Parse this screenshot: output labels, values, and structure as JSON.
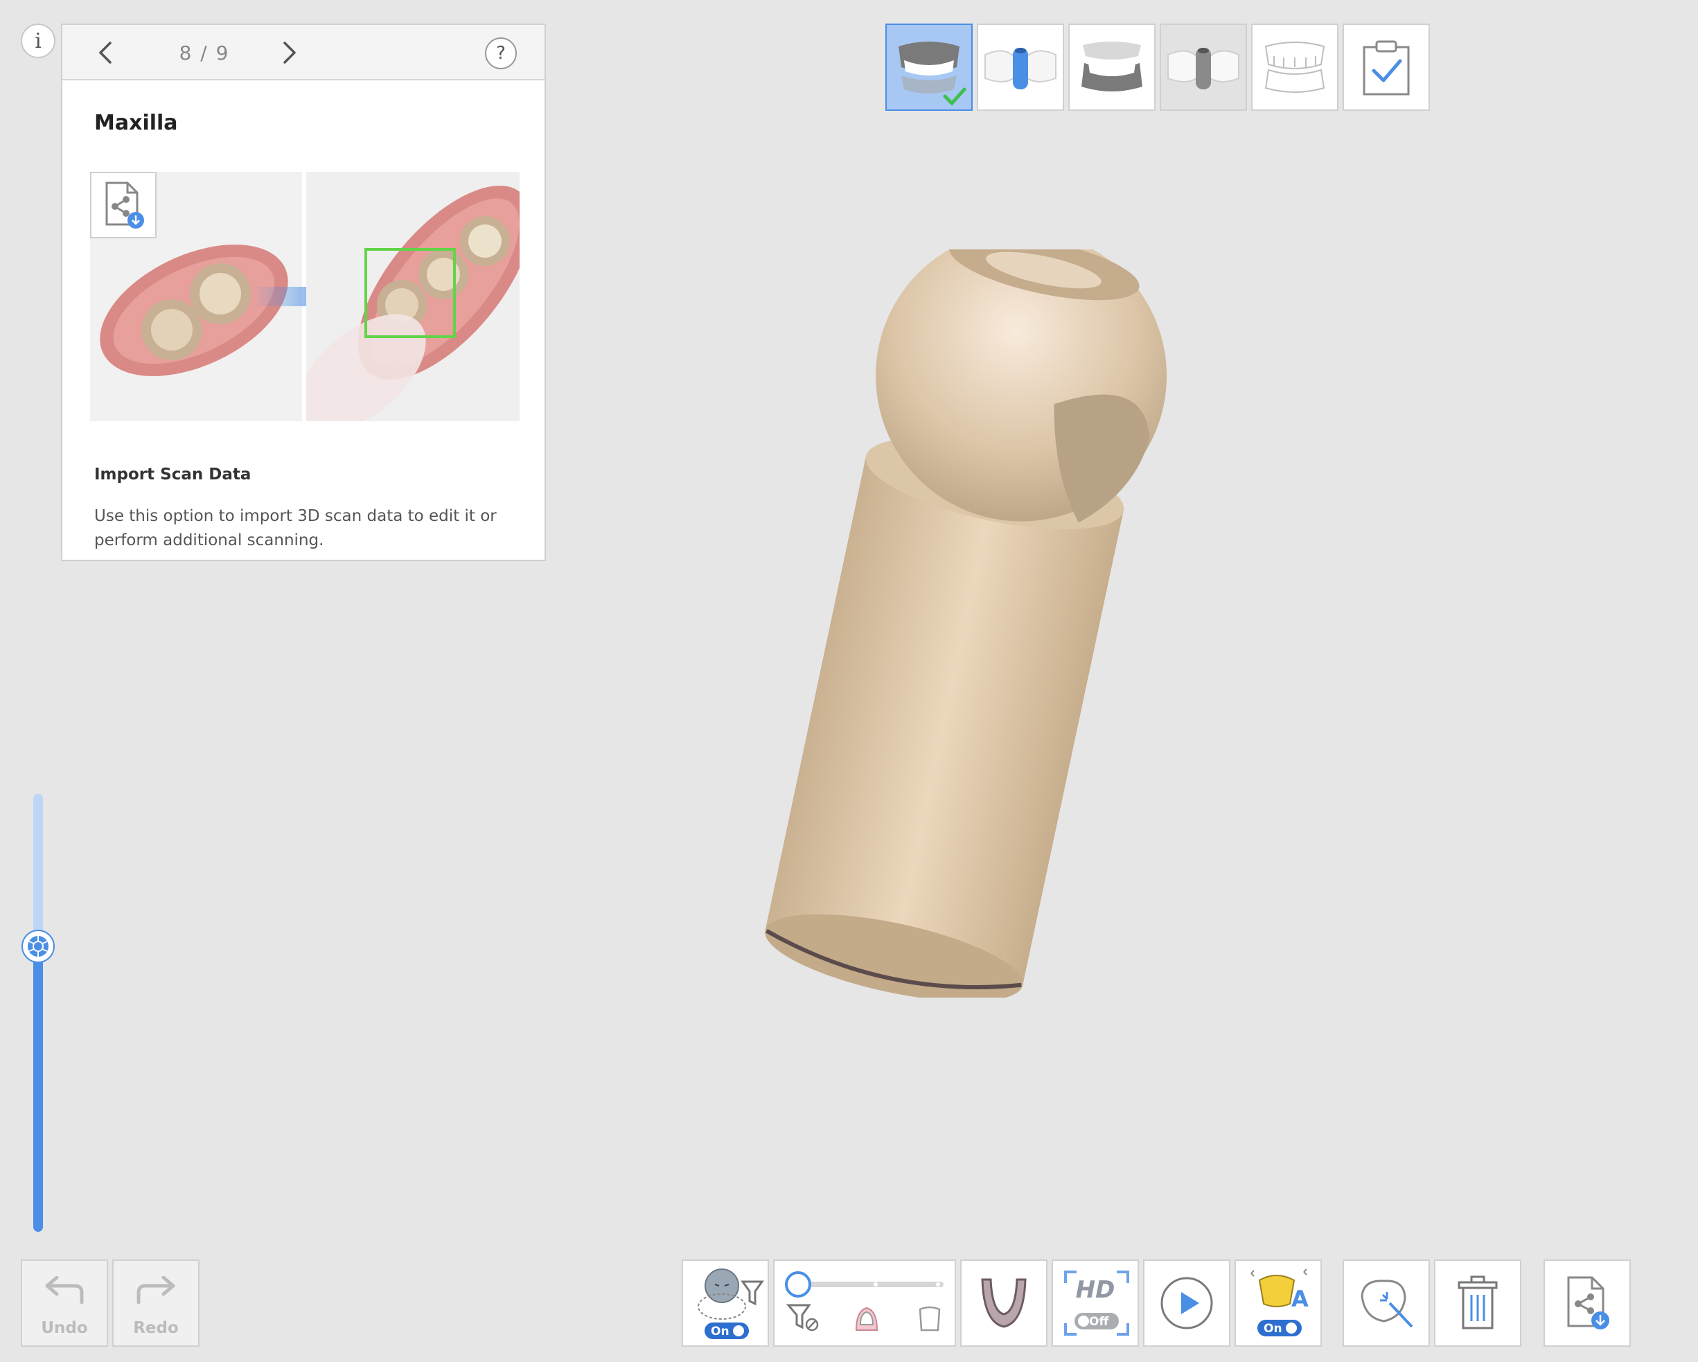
{
  "guide": {
    "page_current": "8",
    "page_total": "9",
    "pager_text": "8 / 9",
    "title": "Maxilla",
    "subtitle": "Import Scan Data",
    "description": "Use this option to import 3D scan data to edit it or perform additional scanning.",
    "help_label": "?"
  },
  "info_label": "i",
  "workflow_steps": [
    {
      "name": "maxilla",
      "icon": "maxilla-teeth-icon",
      "state": "active-complete"
    },
    {
      "name": "maxilla-scanbody",
      "icon": "scanbody-blue-icon",
      "state": "normal"
    },
    {
      "name": "mandible",
      "icon": "mandible-teeth-icon",
      "state": "normal"
    },
    {
      "name": "mandible-scanbody",
      "icon": "scanbody-gray-icon",
      "state": "disabled"
    },
    {
      "name": "occlusion",
      "icon": "occlusion-teeth-icon",
      "state": "normal"
    },
    {
      "name": "review",
      "icon": "clipboard-check-icon",
      "state": "normal"
    }
  ],
  "toolbar": {
    "undo_label": "Undo",
    "redo_label": "Redo",
    "ai_filter_toggle": "On",
    "hd_toggle": "Off",
    "color_toggle": "On",
    "hd_label": "HD"
  },
  "colors": {
    "accent": "#4a8ee6",
    "background": "#e6e6e6",
    "model": "#d8c2a5",
    "success": "#3fbf4e"
  }
}
